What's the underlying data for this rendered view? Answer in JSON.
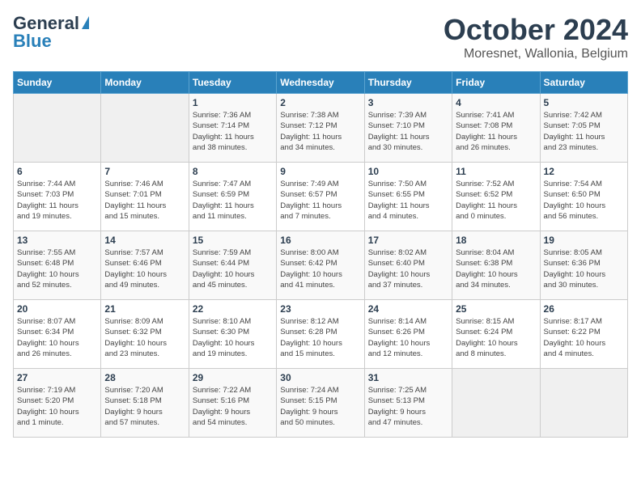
{
  "header": {
    "logo_line1": "General",
    "logo_line2": "Blue",
    "month": "October 2024",
    "location": "Moresnet, Wallonia, Belgium"
  },
  "weekdays": [
    "Sunday",
    "Monday",
    "Tuesday",
    "Wednesday",
    "Thursday",
    "Friday",
    "Saturday"
  ],
  "weeks": [
    [
      {
        "day": "",
        "info": ""
      },
      {
        "day": "",
        "info": ""
      },
      {
        "day": "1",
        "info": "Sunrise: 7:36 AM\nSunset: 7:14 PM\nDaylight: 11 hours\nand 38 minutes."
      },
      {
        "day": "2",
        "info": "Sunrise: 7:38 AM\nSunset: 7:12 PM\nDaylight: 11 hours\nand 34 minutes."
      },
      {
        "day": "3",
        "info": "Sunrise: 7:39 AM\nSunset: 7:10 PM\nDaylight: 11 hours\nand 30 minutes."
      },
      {
        "day": "4",
        "info": "Sunrise: 7:41 AM\nSunset: 7:08 PM\nDaylight: 11 hours\nand 26 minutes."
      },
      {
        "day": "5",
        "info": "Sunrise: 7:42 AM\nSunset: 7:05 PM\nDaylight: 11 hours\nand 23 minutes."
      }
    ],
    [
      {
        "day": "6",
        "info": "Sunrise: 7:44 AM\nSunset: 7:03 PM\nDaylight: 11 hours\nand 19 minutes."
      },
      {
        "day": "7",
        "info": "Sunrise: 7:46 AM\nSunset: 7:01 PM\nDaylight: 11 hours\nand 15 minutes."
      },
      {
        "day": "8",
        "info": "Sunrise: 7:47 AM\nSunset: 6:59 PM\nDaylight: 11 hours\nand 11 minutes."
      },
      {
        "day": "9",
        "info": "Sunrise: 7:49 AM\nSunset: 6:57 PM\nDaylight: 11 hours\nand 7 minutes."
      },
      {
        "day": "10",
        "info": "Sunrise: 7:50 AM\nSunset: 6:55 PM\nDaylight: 11 hours\nand 4 minutes."
      },
      {
        "day": "11",
        "info": "Sunrise: 7:52 AM\nSunset: 6:52 PM\nDaylight: 11 hours\nand 0 minutes."
      },
      {
        "day": "12",
        "info": "Sunrise: 7:54 AM\nSunset: 6:50 PM\nDaylight: 10 hours\nand 56 minutes."
      }
    ],
    [
      {
        "day": "13",
        "info": "Sunrise: 7:55 AM\nSunset: 6:48 PM\nDaylight: 10 hours\nand 52 minutes."
      },
      {
        "day": "14",
        "info": "Sunrise: 7:57 AM\nSunset: 6:46 PM\nDaylight: 10 hours\nand 49 minutes."
      },
      {
        "day": "15",
        "info": "Sunrise: 7:59 AM\nSunset: 6:44 PM\nDaylight: 10 hours\nand 45 minutes."
      },
      {
        "day": "16",
        "info": "Sunrise: 8:00 AM\nSunset: 6:42 PM\nDaylight: 10 hours\nand 41 minutes."
      },
      {
        "day": "17",
        "info": "Sunrise: 8:02 AM\nSunset: 6:40 PM\nDaylight: 10 hours\nand 37 minutes."
      },
      {
        "day": "18",
        "info": "Sunrise: 8:04 AM\nSunset: 6:38 PM\nDaylight: 10 hours\nand 34 minutes."
      },
      {
        "day": "19",
        "info": "Sunrise: 8:05 AM\nSunset: 6:36 PM\nDaylight: 10 hours\nand 30 minutes."
      }
    ],
    [
      {
        "day": "20",
        "info": "Sunrise: 8:07 AM\nSunset: 6:34 PM\nDaylight: 10 hours\nand 26 minutes."
      },
      {
        "day": "21",
        "info": "Sunrise: 8:09 AM\nSunset: 6:32 PM\nDaylight: 10 hours\nand 23 minutes."
      },
      {
        "day": "22",
        "info": "Sunrise: 8:10 AM\nSunset: 6:30 PM\nDaylight: 10 hours\nand 19 minutes."
      },
      {
        "day": "23",
        "info": "Sunrise: 8:12 AM\nSunset: 6:28 PM\nDaylight: 10 hours\nand 15 minutes."
      },
      {
        "day": "24",
        "info": "Sunrise: 8:14 AM\nSunset: 6:26 PM\nDaylight: 10 hours\nand 12 minutes."
      },
      {
        "day": "25",
        "info": "Sunrise: 8:15 AM\nSunset: 6:24 PM\nDaylight: 10 hours\nand 8 minutes."
      },
      {
        "day": "26",
        "info": "Sunrise: 8:17 AM\nSunset: 6:22 PM\nDaylight: 10 hours\nand 4 minutes."
      }
    ],
    [
      {
        "day": "27",
        "info": "Sunrise: 7:19 AM\nSunset: 5:20 PM\nDaylight: 10 hours\nand 1 minute."
      },
      {
        "day": "28",
        "info": "Sunrise: 7:20 AM\nSunset: 5:18 PM\nDaylight: 9 hours\nand 57 minutes."
      },
      {
        "day": "29",
        "info": "Sunrise: 7:22 AM\nSunset: 5:16 PM\nDaylight: 9 hours\nand 54 minutes."
      },
      {
        "day": "30",
        "info": "Sunrise: 7:24 AM\nSunset: 5:15 PM\nDaylight: 9 hours\nand 50 minutes."
      },
      {
        "day": "31",
        "info": "Sunrise: 7:25 AM\nSunset: 5:13 PM\nDaylight: 9 hours\nand 47 minutes."
      },
      {
        "day": "",
        "info": ""
      },
      {
        "day": "",
        "info": ""
      }
    ]
  ]
}
